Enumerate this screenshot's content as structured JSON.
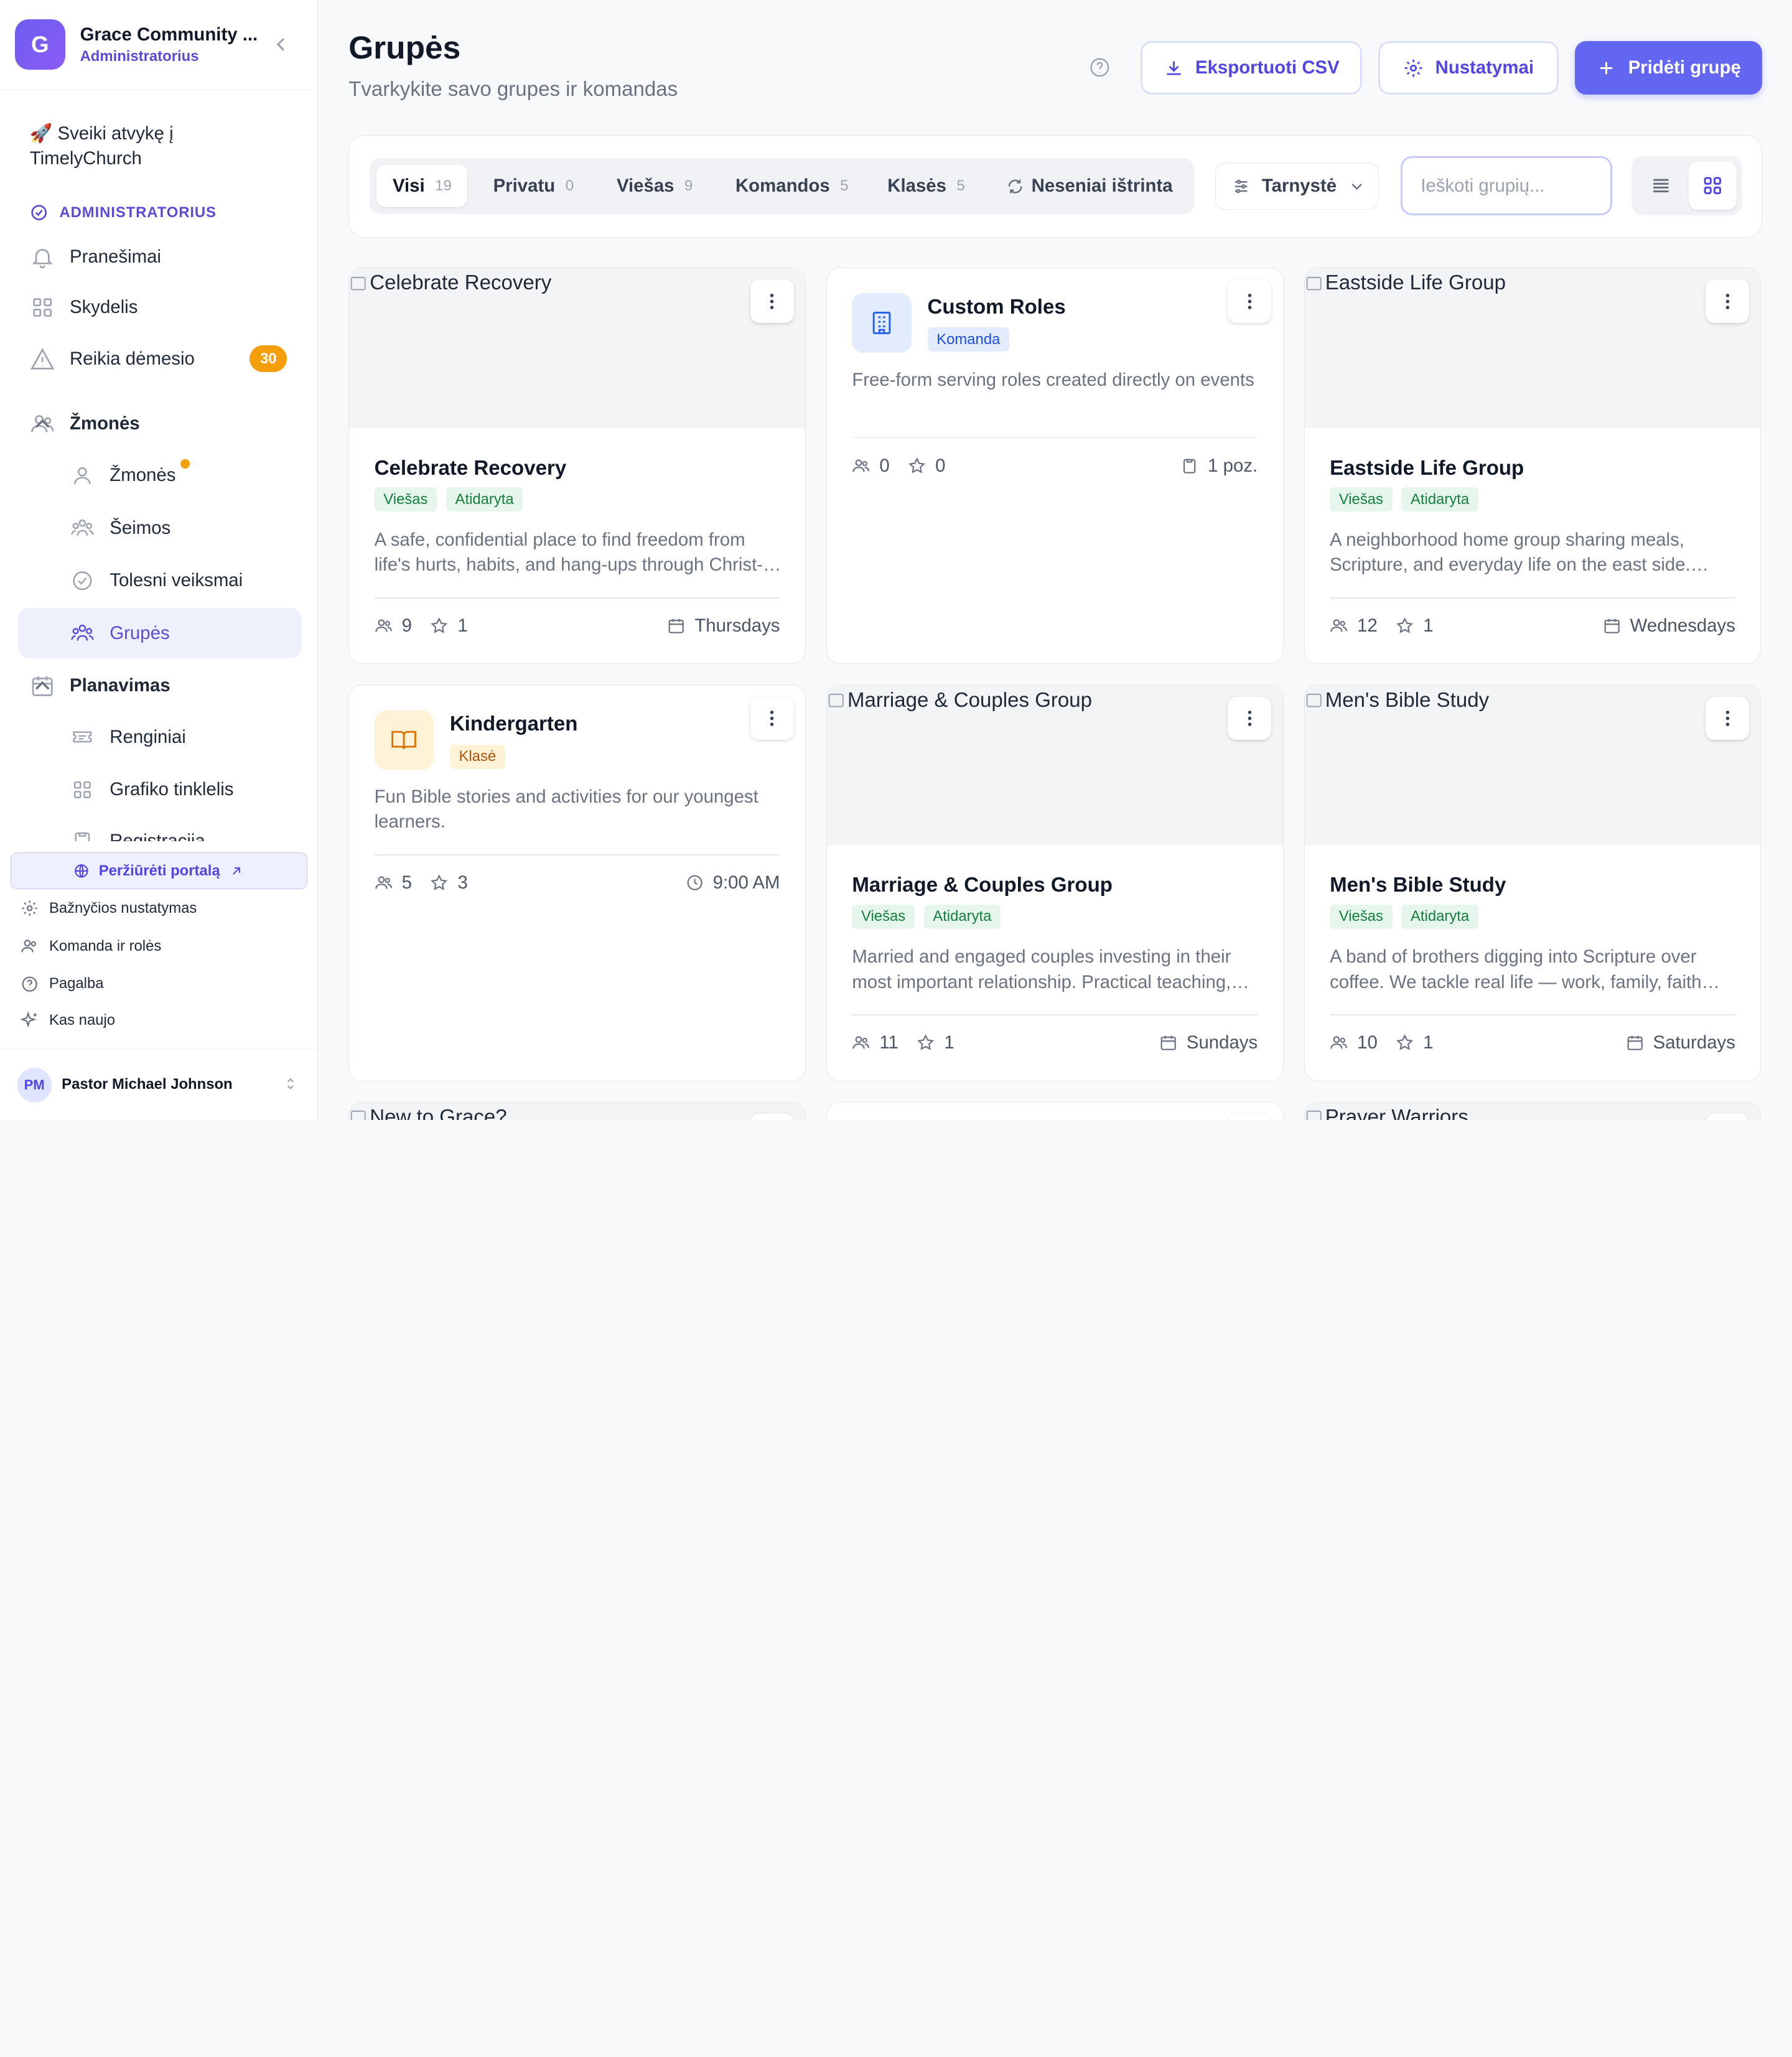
{
  "sidebar": {
    "org_initial": "G",
    "org_name": "Grace Community ...",
    "org_role": "Administratorius",
    "welcome": "🚀 Sveiki atvykę į TimelyChurch",
    "admin_label": "ADMINISTRATORIUS",
    "items": {
      "notifications": "Pranešimai",
      "dashboard": "Skydelis",
      "attention": "Reikia dėmesio",
      "attention_count": "30",
      "people_section": "Žmonės",
      "people": "Žmonės",
      "families": "Šeimos",
      "followups": "Tolesni veiksmai",
      "groups": "Grupės",
      "planning_section": "Planavimas",
      "events": "Renginiai",
      "schedule": "Grafiko tinklelis",
      "registrations": "Registracija"
    },
    "portal_button": "Peržiūrėti portalą",
    "links": {
      "church_settings": "Bažnyčios nustatymas",
      "team_roles": "Komanda ir rolės",
      "help": "Pagalba",
      "whats_new": "Kas naujo"
    },
    "user": {
      "initials": "PM",
      "name": "Pastor Michael Johnson"
    }
  },
  "header": {
    "title": "Grupės",
    "subtitle": "Tvarkykite savo grupes ir komandas",
    "export_label": "Eksportuoti CSV",
    "settings_label": "Nustatymai",
    "add_label": "Pridėti grupę"
  },
  "filters": {
    "tabs": [
      {
        "label": "Visi",
        "count": "19"
      },
      {
        "label": "Privatu",
        "count": "0"
      },
      {
        "label": "Viešas",
        "count": "9"
      },
      {
        "label": "Komandos",
        "count": "5"
      },
      {
        "label": "Klasės",
        "count": "5"
      },
      {
        "label": "Neseniai ištrinta",
        "count": ""
      }
    ],
    "sort_label": "Tarnystė",
    "search_placeholder": "Ieškoti grupių..."
  },
  "groups": [
    {
      "name": "Celebrate Recovery",
      "image_alt": "Celebrate Recovery",
      "tags": [
        "Viešas",
        "Atidaryta"
      ],
      "description": "A safe, confidential place to find freedom from life's hurts, habits, and hang-ups through Christ-centered recovery.",
      "members": "9",
      "leaders": "1",
      "schedule": "Thursdays"
    },
    {
      "name": "Custom Roles",
      "type_tag": "Komanda",
      "icon": "building-icon",
      "description": "Free-form serving roles created directly on events",
      "members": "0",
      "leaders": "0",
      "positions": "1 poz."
    },
    {
      "name": "Eastside Life Group",
      "image_alt": "Eastside Life Group",
      "tags": [
        "Viešas",
        "Atidaryta"
      ],
      "description": "A neighborhood home group sharing meals, Scripture, and everyday life on the east side. Everyone welcome.",
      "members": "12",
      "leaders": "1",
      "schedule": "Wednesdays"
    },
    {
      "name": "Kindergarten",
      "type_tag": "Klasė",
      "icon": "book-icon",
      "description": "Fun Bible stories and activities for our youngest learners.",
      "members": "5",
      "leaders": "3",
      "time": "9:00 AM"
    },
    {
      "name": "Marriage & Couples Group",
      "image_alt": "Marriage & Couples Group",
      "tags": [
        "Viešas",
        "Atidaryta"
      ],
      "description": "Married and engaged couples investing in their most important relationship. Practical teaching, honest talk.",
      "members": "11",
      "leaders": "1",
      "schedule": "Sundays"
    },
    {
      "name": "Men's Bible Study",
      "image_alt": "Men's Bible Study",
      "tags": [
        "Viešas",
        "Atidaryta"
      ],
      "description": "A band of brothers digging into Scripture over coffee. We tackle real life — work, family, faith and more.",
      "members": "10",
      "leaders": "1",
      "schedule": "Saturdays"
    },
    {
      "image_alt": "New to Grace?"
    },
    {
      "image_alt": ""
    },
    {
      "image_alt": "Prayer Warriors"
    }
  ],
  "colors": {
    "accent": "#6366f1",
    "warning": "#f59e0b",
    "public_tag": "#15803d"
  }
}
